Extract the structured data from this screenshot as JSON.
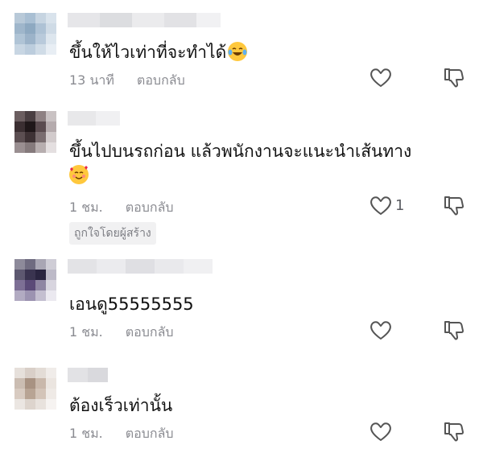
{
  "comments": [
    {
      "text": "ขึ้นให้ไวเท่าที่จะทำได้",
      "emoji": "face-with-tears-of-joy",
      "time": "13 นาที",
      "reply_label": "ตอบกลับ",
      "likes": ""
    },
    {
      "text_line1": "ขึ้นไปบนรถก่อน แล้วพนักงานจะแนะนำเส้นทาง",
      "emoji": "smiling-face-with-hearts",
      "time": "1 ชม.",
      "reply_label": "ตอบกลับ",
      "likes": "1",
      "badge": "ถูกใจโดยผู้สร้าง"
    },
    {
      "text": "เอนดู55555555",
      "time": "1 ชม.",
      "reply_label": "ตอบกลับ",
      "likes": ""
    },
    {
      "text": "ต้องเร็วเท่านั้น",
      "time": "1 ชม.",
      "reply_label": "ตอบกลับ",
      "likes": ""
    }
  ],
  "colors": {
    "meta_text": "#8a8b91",
    "badge_bg": "#f1f1f2",
    "icon_stroke": "#555555"
  }
}
